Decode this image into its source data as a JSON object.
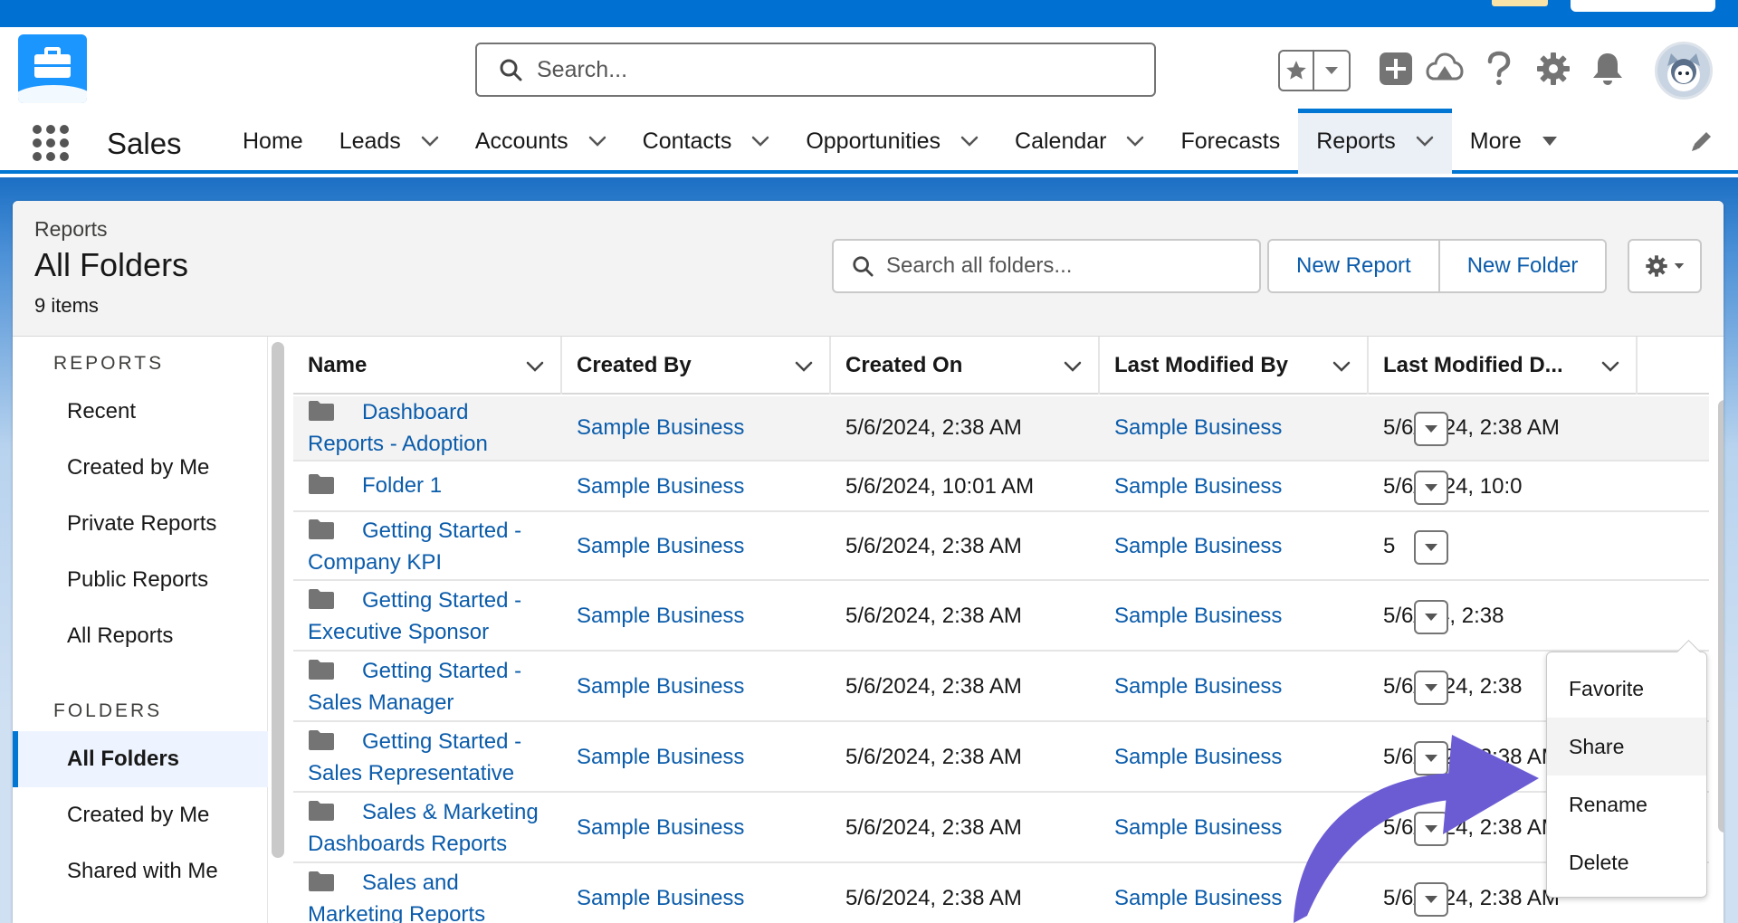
{
  "global_header": {
    "search_placeholder": "Search..."
  },
  "nav": {
    "app_name": "Sales",
    "items": [
      {
        "label": "Home",
        "has_menu": false
      },
      {
        "label": "Leads",
        "has_menu": true
      },
      {
        "label": "Accounts",
        "has_menu": true
      },
      {
        "label": "Contacts",
        "has_menu": true
      },
      {
        "label": "Opportunities",
        "has_menu": true
      },
      {
        "label": "Calendar",
        "has_menu": true
      },
      {
        "label": "Forecasts",
        "has_menu": false
      },
      {
        "label": "Reports",
        "has_menu": true,
        "active": true
      },
      {
        "label": "More",
        "has_menu": true
      }
    ]
  },
  "page_header": {
    "breadcrumb": "Reports",
    "title": "All Folders",
    "count": "9 items",
    "search_placeholder": "Search all folders...",
    "new_report_label": "New Report",
    "new_folder_label": "New Folder"
  },
  "sidebar": {
    "reports_heading": "REPORTS",
    "reports_items": [
      "Recent",
      "Created by Me",
      "Private Reports",
      "Public Reports",
      "All Reports"
    ],
    "folders_heading": "FOLDERS",
    "folders_items": [
      "All Folders",
      "Created by Me",
      "Shared with Me"
    ],
    "active_item": "All Folders"
  },
  "table": {
    "columns": [
      "Name",
      "Created By",
      "Created On",
      "Last Modified By",
      "Last Modified D..."
    ],
    "rows": [
      {
        "name": [
          "Dashboard",
          "Reports - Adoption"
        ],
        "created_by": "Sample Business",
        "created_on": "5/6/2024, 2:38 AM",
        "modified_by": "Sample Business",
        "modified_on": "5/6/2024, 2:38 AM"
      },
      {
        "name": [
          "Folder 1"
        ],
        "created_by": "Sample Business",
        "created_on": "5/6/2024, 10:01 AM",
        "modified_by": "Sample Business",
        "modified_on": "5/6/2024, 10:0"
      },
      {
        "name": [
          "Getting Started -",
          "Company KPI"
        ],
        "created_by": "Sample Business",
        "created_on": "5/6/2024, 2:38 AM",
        "modified_by": "Sample Business",
        "modified_on": "5"
      },
      {
        "name": [
          "Getting Started -",
          "Executive Sponsor"
        ],
        "created_by": "Sample Business",
        "created_on": "5/6/2024, 2:38 AM",
        "modified_by": "Sample Business",
        "modified_on": "5/6/2  4, 2:38"
      },
      {
        "name": [
          "Getting Started -",
          "Sales Manager"
        ],
        "created_by": "Sample Business",
        "created_on": "5/6/2024, 2:38 AM",
        "modified_by": "Sample Business",
        "modified_on": "5/6/2024, 2:38"
      },
      {
        "name": [
          "Getting Started -",
          "Sales Representative"
        ],
        "created_by": "Sample Business",
        "created_on": "5/6/2024, 2:38 AM",
        "modified_by": "Sample Business",
        "modified_on": "5/6/2024, 2:38 AM"
      },
      {
        "name": [
          "Sales & Marketing",
          "Dashboards Reports"
        ],
        "created_by": "Sample Business",
        "created_on": "5/6/2024, 2:38 AM",
        "modified_by": "Sample Business",
        "modified_on": "5/6/2024, 2:38 AM"
      },
      {
        "name": [
          "Sales and",
          "Marketing Reports"
        ],
        "created_by": "Sample Business",
        "created_on": "5/6/2024, 2:38 AM",
        "modified_by": "Sample Business",
        "modified_on": "5/6/2024, 2:38 AM"
      }
    ]
  },
  "row_menu": {
    "items": [
      "Favorite",
      "Share",
      "Rename",
      "Delete"
    ],
    "hovered": "Share"
  },
  "colors": {
    "brand_blue": "#0176d3",
    "link_blue": "#0b5cab",
    "annotation_arrow": "#6b5cd4"
  },
  "icons": [
    "search-icon",
    "star-icon",
    "add-icon",
    "trailhead-icon",
    "help-icon",
    "gear-icon",
    "bell-icon",
    "waffle-icon",
    "chevron-down-icon",
    "pencil-icon",
    "folder-icon"
  ]
}
